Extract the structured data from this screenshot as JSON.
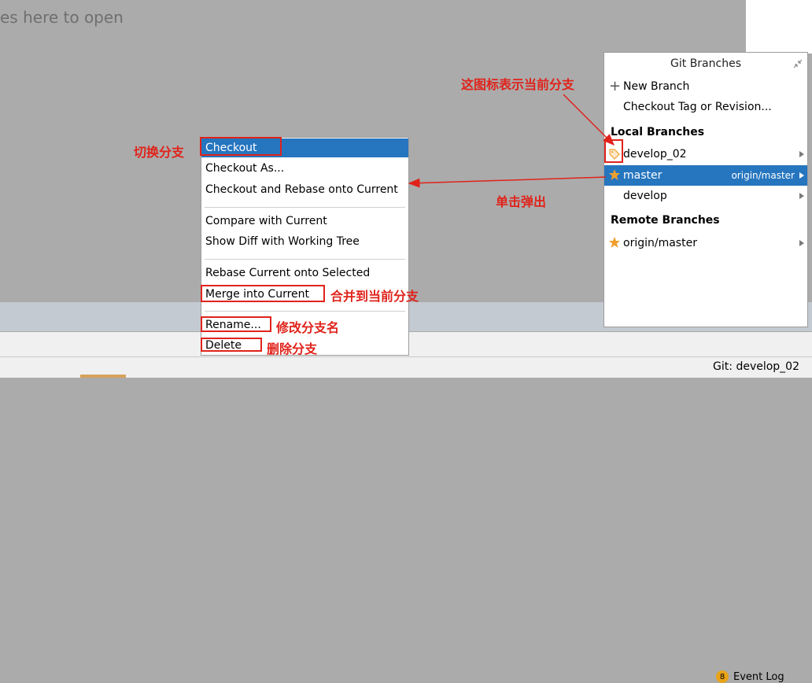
{
  "editor": {
    "hint": "es here to open"
  },
  "git_branches": {
    "title": "Git Branches",
    "new_branch": "New Branch",
    "checkout_tag": "Checkout Tag or Revision...",
    "local_header": "Local Branches",
    "local": [
      {
        "name": "develop_02",
        "remote": "",
        "icon": "tag-icon"
      },
      {
        "name": "master",
        "remote": "origin/master",
        "icon": "star-icon"
      },
      {
        "name": "develop",
        "remote": "",
        "icon": ""
      }
    ],
    "remote_header": "Remote Branches",
    "remote": [
      {
        "name": "origin/master",
        "icon": "star-icon"
      }
    ]
  },
  "context_menu": {
    "items": [
      "Checkout",
      "Checkout As...",
      "Checkout and Rebase onto Current",
      "Compare with Current",
      "Show Diff with Working Tree",
      "Rebase Current onto Selected",
      "Merge into Current",
      "Rename...",
      "Delete"
    ]
  },
  "statusbar": {
    "event_log": "Event Log",
    "event_count": "8",
    "git_branch": "Git: develop_02"
  },
  "annotations": {
    "current_branch_icon": "这图标表示当前分支",
    "switch_branch": "切换分支",
    "click_popup": "单击弹出",
    "merge": "合并到当前分支",
    "rename": "修改分支名",
    "delete": "删除分支"
  },
  "colors": {
    "selection": "#2675bf",
    "annotation": "#e0231b",
    "star": "#f0a030",
    "badge": "#e8a317"
  }
}
